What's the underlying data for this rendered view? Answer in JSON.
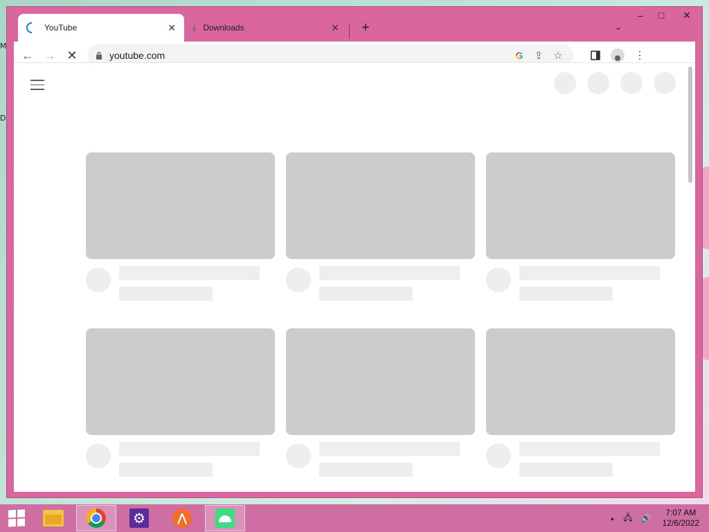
{
  "desktop": {
    "icon_labels": [
      "M",
      "D"
    ]
  },
  "window_controls": {
    "minimize": "–",
    "maximize": "□",
    "close": "✕"
  },
  "tabs": [
    {
      "title": "YouTube",
      "icon": "loading-spinner-icon",
      "close": "✕"
    },
    {
      "title": "Downloads",
      "icon": "download-icon",
      "close": "✕"
    }
  ],
  "tabstrip": {
    "new_tab": "+",
    "search_tabs": "⌄"
  },
  "toolbar": {
    "back": "←",
    "forward": "→",
    "stop": "✕",
    "lock_icon": "lock-icon",
    "url": "youtube.com",
    "google_lens": "G",
    "share": "⇪",
    "bookmark": "☆",
    "side_panel": "▮",
    "menu": "⋮"
  },
  "taskbar": {
    "apps": [
      "file-explorer-icon",
      "chrome-icon",
      "settings-icon",
      "app-icon",
      "android-studio-icon"
    ],
    "tray": {
      "chevron": "▲",
      "network": "🖧",
      "volume": "🔊"
    },
    "time": "7:07 AM",
    "date": "12/6/2022"
  },
  "colors": {
    "window_frame": "#d9679e",
    "taskbar": "#cf6ea2",
    "skeleton_thumb": "#cccccc",
    "skeleton_light": "#eeeeee"
  }
}
